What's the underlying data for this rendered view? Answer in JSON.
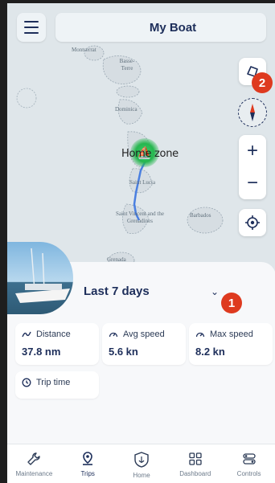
{
  "header": {
    "title": "My Boat",
    "menu_icon": "hamburger-menu-icon"
  },
  "map": {
    "home_label": "Home zone",
    "islands": [
      "Montserrat",
      "Basse-Terre",
      "Dominica",
      "Saint Lucia",
      "Saint Vincent and the Grenadines",
      "Barbados",
      "Grenada"
    ],
    "controls": {
      "zoom_in": "+",
      "zoom_out": "−"
    }
  },
  "badges": {
    "map_badge": "2",
    "period_badge": "1"
  },
  "trips": {
    "period_title": "Last 7 days",
    "stats": [
      {
        "label": "Distance",
        "value": "37.8 nm"
      },
      {
        "label": "Avg speed",
        "value": "5.6 kn"
      },
      {
        "label": "Max speed",
        "value": "8.2 kn"
      },
      {
        "label": "Trip time",
        "value": ""
      }
    ]
  },
  "nav": [
    {
      "label": "Maintenance"
    },
    {
      "label": "Trips"
    },
    {
      "label": "Home"
    },
    {
      "label": "Dashboard"
    },
    {
      "label": "Controls"
    }
  ],
  "colors": {
    "accent": "#1d2e5a",
    "badge": "#de3a1f",
    "home_zone": "#26b64f",
    "route": "#4a7fe0"
  }
}
